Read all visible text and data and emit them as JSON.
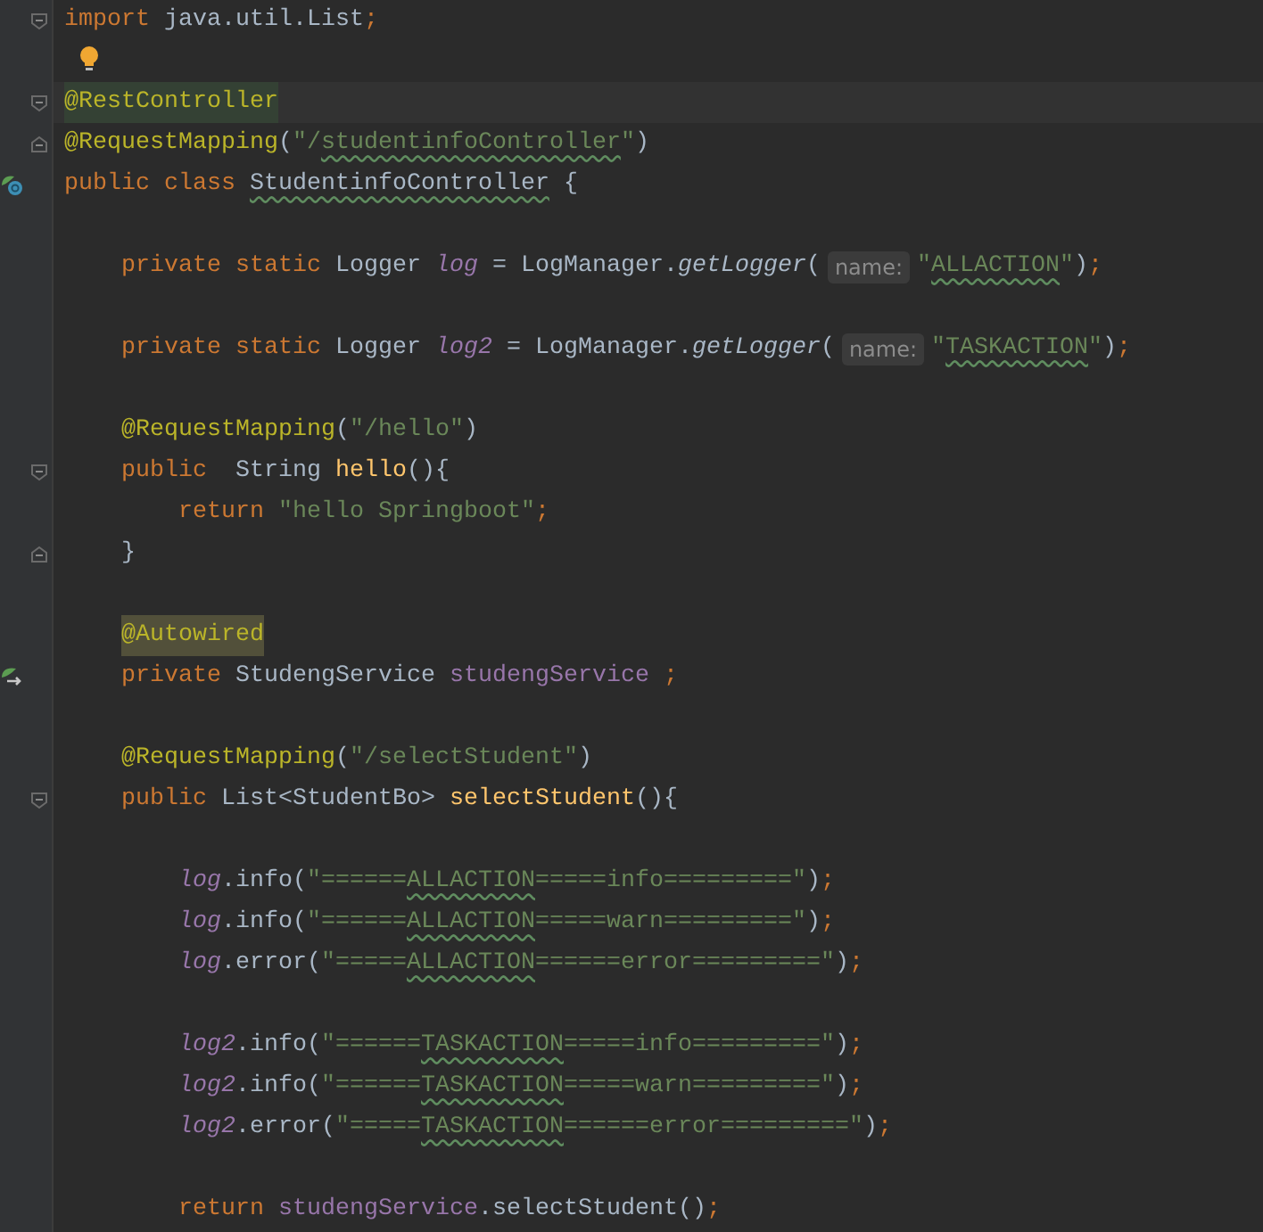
{
  "editor": {
    "lines": [
      {
        "kind": "code",
        "fold": {
          "kind": "open"
        },
        "tokens": [
          {
            "kind": "keyword",
            "text": "import"
          },
          {
            "kind": "plain",
            "text": " java.util.List"
          },
          {
            "kind": "keyword",
            "text": ";"
          }
        ]
      },
      {
        "kind": "blank",
        "bulb": true
      },
      {
        "kind": "code",
        "current": true,
        "fold": {
          "kind": "open"
        },
        "tokens": [
          {
            "kind": "annotation",
            "text": "@RestController",
            "highlight": {
              "kind": "caret"
            }
          }
        ]
      },
      {
        "kind": "code",
        "fold": {
          "kind": "close"
        },
        "tokens": [
          {
            "kind": "annotation",
            "text": "@RequestMapping"
          },
          {
            "kind": "plain",
            "text": "("
          },
          {
            "kind": "string",
            "text": "\"/"
          },
          {
            "kind": "string_typo",
            "text": "studentinfoController"
          },
          {
            "kind": "string",
            "text": "\""
          },
          {
            "kind": "plain",
            "text": ")"
          }
        ]
      },
      {
        "kind": "code",
        "gutter_icon": {
          "kind": "bean_class"
        },
        "tokens": [
          {
            "kind": "keyword",
            "text": "public class "
          },
          {
            "kind": "plain_typo",
            "text": "StudentinfoController"
          },
          {
            "kind": "plain",
            "text": " {"
          }
        ],
        "children": [
          {
            "kind": "blank"
          },
          {
            "kind": "code",
            "tokens": [
              {
                "kind": "keyword",
                "text": "private static "
              },
              {
                "kind": "plain",
                "text": "Logger "
              },
              {
                "kind": "field_italic",
                "text": "log"
              },
              {
                "kind": "plain",
                "text": " = LogManager."
              },
              {
                "kind": "method_italic",
                "text": "getLogger"
              },
              {
                "kind": "plain",
                "text": "("
              },
              {
                "kind": "hint",
                "text": "name:"
              },
              {
                "kind": "string",
                "text": "\""
              },
              {
                "kind": "string_typo",
                "text": "ALLACTION"
              },
              {
                "kind": "string",
                "text": "\""
              },
              {
                "kind": "plain",
                "text": ")"
              },
              {
                "kind": "keyword",
                "text": ";"
              }
            ]
          },
          {
            "kind": "blank"
          },
          {
            "kind": "code",
            "tokens": [
              {
                "kind": "keyword",
                "text": "private static "
              },
              {
                "kind": "plain",
                "text": "Logger "
              },
              {
                "kind": "field_italic",
                "text": "log2"
              },
              {
                "kind": "plain",
                "text": " = LogManager."
              },
              {
                "kind": "method_italic",
                "text": "getLogger"
              },
              {
                "kind": "plain",
                "text": "("
              },
              {
                "kind": "hint",
                "text": "name:"
              },
              {
                "kind": "string",
                "text": "\""
              },
              {
                "kind": "string_typo",
                "text": "TASKACTION"
              },
              {
                "kind": "string",
                "text": "\""
              },
              {
                "kind": "plain",
                "text": ")"
              },
              {
                "kind": "keyword",
                "text": ";"
              }
            ]
          },
          {
            "kind": "blank"
          },
          {
            "kind": "code",
            "tokens": [
              {
                "kind": "annotation",
                "text": "@RequestMapping"
              },
              {
                "kind": "plain",
                "text": "("
              },
              {
                "kind": "string",
                "text": "\"/hello\""
              },
              {
                "kind": "plain",
                "text": ")"
              }
            ]
          },
          {
            "kind": "code",
            "fold": {
              "kind": "open"
            },
            "tokens": [
              {
                "kind": "keyword",
                "text": "public"
              },
              {
                "kind": "plain",
                "text": "  String "
              },
              {
                "kind": "method_decl",
                "text": "hello"
              },
              {
                "kind": "plain",
                "text": "(){"
              }
            ],
            "children": [
              {
                "kind": "code",
                "tokens": [
                  {
                    "kind": "keyword",
                    "text": "return "
                  },
                  {
                    "kind": "string",
                    "text": "\"hello Springboot\""
                  },
                  {
                    "kind": "keyword",
                    "text": ";"
                  }
                ]
              }
            ]
          },
          {
            "kind": "code",
            "fold": {
              "kind": "close"
            },
            "tokens": [
              {
                "kind": "plain",
                "text": "}"
              }
            ]
          },
          {
            "kind": "blank"
          },
          {
            "kind": "code",
            "tokens": [
              {
                "kind": "annotation",
                "text": "@Autowired",
                "highlight": {
                  "kind": "usage"
                }
              }
            ]
          },
          {
            "kind": "code",
            "gutter_icon": {
              "kind": "bean_field"
            },
            "tokens": [
              {
                "kind": "keyword",
                "text": "private "
              },
              {
                "kind": "plain",
                "text": "StudengService "
              },
              {
                "kind": "field",
                "text": "studengService"
              },
              {
                "kind": "keyword",
                "text": " ;"
              }
            ]
          },
          {
            "kind": "blank"
          },
          {
            "kind": "code",
            "tokens": [
              {
                "kind": "annotation",
                "text": "@RequestMapping"
              },
              {
                "kind": "plain",
                "text": "("
              },
              {
                "kind": "string",
                "text": "\"/selectStudent\""
              },
              {
                "kind": "plain",
                "text": ")"
              }
            ]
          },
          {
            "kind": "code",
            "fold": {
              "kind": "open"
            },
            "tokens": [
              {
                "kind": "keyword",
                "text": "public "
              },
              {
                "kind": "plain",
                "text": "List<StudentBo> "
              },
              {
                "kind": "method_decl",
                "text": "selectStudent"
              },
              {
                "kind": "plain",
                "text": "(){"
              }
            ],
            "children": [
              {
                "kind": "blank"
              },
              {
                "kind": "code",
                "tokens": [
                  {
                    "kind": "field_italic",
                    "text": "log"
                  },
                  {
                    "kind": "plain",
                    "text": ".info("
                  },
                  {
                    "kind": "string",
                    "text": "\"======"
                  },
                  {
                    "kind": "string_typo",
                    "text": "ALLACTION"
                  },
                  {
                    "kind": "string",
                    "text": "=====info=========\""
                  },
                  {
                    "kind": "plain",
                    "text": ")"
                  },
                  {
                    "kind": "keyword",
                    "text": ";"
                  }
                ]
              },
              {
                "kind": "code",
                "tokens": [
                  {
                    "kind": "field_italic",
                    "text": "log"
                  },
                  {
                    "kind": "plain",
                    "text": ".info("
                  },
                  {
                    "kind": "string",
                    "text": "\"======"
                  },
                  {
                    "kind": "string_typo",
                    "text": "ALLACTION"
                  },
                  {
                    "kind": "string",
                    "text": "=====warn=========\""
                  },
                  {
                    "kind": "plain",
                    "text": ")"
                  },
                  {
                    "kind": "keyword",
                    "text": ";"
                  }
                ]
              },
              {
                "kind": "code",
                "tokens": [
                  {
                    "kind": "field_italic",
                    "text": "log"
                  },
                  {
                    "kind": "plain",
                    "text": ".error("
                  },
                  {
                    "kind": "string",
                    "text": "\"====="
                  },
                  {
                    "kind": "string_typo",
                    "text": "ALLACTION"
                  },
                  {
                    "kind": "string",
                    "text": "======error=========\""
                  },
                  {
                    "kind": "plain",
                    "text": ")"
                  },
                  {
                    "kind": "keyword",
                    "text": ";"
                  }
                ]
              },
              {
                "kind": "blank"
              },
              {
                "kind": "code",
                "tokens": [
                  {
                    "kind": "field_italic",
                    "text": "log2"
                  },
                  {
                    "kind": "plain",
                    "text": ".info("
                  },
                  {
                    "kind": "string",
                    "text": "\"======"
                  },
                  {
                    "kind": "string_typo",
                    "text": "TASKACTION"
                  },
                  {
                    "kind": "string",
                    "text": "=====info=========\""
                  },
                  {
                    "kind": "plain",
                    "text": ")"
                  },
                  {
                    "kind": "keyword",
                    "text": ";"
                  }
                ]
              },
              {
                "kind": "code",
                "tokens": [
                  {
                    "kind": "field_italic",
                    "text": "log2"
                  },
                  {
                    "kind": "plain",
                    "text": ".info("
                  },
                  {
                    "kind": "string",
                    "text": "\"======"
                  },
                  {
                    "kind": "string_typo",
                    "text": "TASKACTION"
                  },
                  {
                    "kind": "string",
                    "text": "=====warn=========\""
                  },
                  {
                    "kind": "plain",
                    "text": ")"
                  },
                  {
                    "kind": "keyword",
                    "text": ";"
                  }
                ]
              },
              {
                "kind": "code",
                "tokens": [
                  {
                    "kind": "field_italic",
                    "text": "log2"
                  },
                  {
                    "kind": "plain",
                    "text": ".error("
                  },
                  {
                    "kind": "string",
                    "text": "\"====="
                  },
                  {
                    "kind": "string_typo",
                    "text": "TASKACTION"
                  },
                  {
                    "kind": "string",
                    "text": "======error=========\""
                  },
                  {
                    "kind": "plain",
                    "text": ")"
                  },
                  {
                    "kind": "keyword",
                    "text": ";"
                  }
                ]
              },
              {
                "kind": "blank"
              },
              {
                "kind": "code",
                "tokens": [
                  {
                    "kind": "keyword",
                    "text": "return "
                  },
                  {
                    "kind": "field",
                    "text": "studengService"
                  },
                  {
                    "kind": "plain",
                    "text": ".selectStudent()"
                  },
                  {
                    "kind": "keyword",
                    "text": ";"
                  }
                ]
              }
            ]
          }
        ]
      }
    ]
  }
}
